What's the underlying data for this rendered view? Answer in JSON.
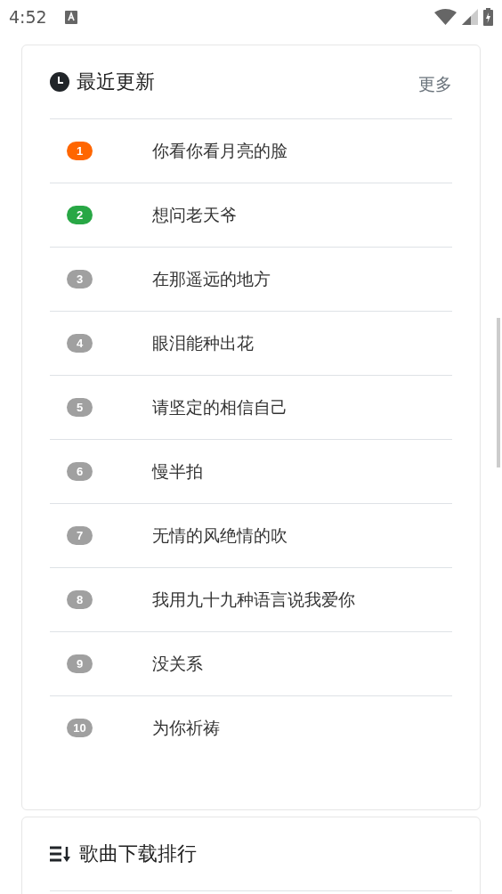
{
  "status_bar": {
    "time": "4:52"
  },
  "recent": {
    "title": "最近更新",
    "more": "更多",
    "items": [
      {
        "rank": "1",
        "title": "你看你看月亮的脸",
        "color": "#ff6600"
      },
      {
        "rank": "2",
        "title": "想问老天爷",
        "color": "#28a745"
      },
      {
        "rank": "3",
        "title": "在那遥远的地方",
        "color": "#a0a0a0"
      },
      {
        "rank": "4",
        "title": "眼泪能种出花",
        "color": "#a0a0a0"
      },
      {
        "rank": "5",
        "title": "请坚定的相信自己",
        "color": "#a0a0a0"
      },
      {
        "rank": "6",
        "title": "慢半拍",
        "color": "#a0a0a0"
      },
      {
        "rank": "7",
        "title": "无情的风绝情的吹",
        "color": "#a0a0a0"
      },
      {
        "rank": "8",
        "title": "我用九十九种语言说我爱你",
        "color": "#a0a0a0"
      },
      {
        "rank": "9",
        "title": "没关系",
        "color": "#a0a0a0"
      },
      {
        "rank": "10",
        "title": "为你祈祷",
        "color": "#a0a0a0"
      }
    ]
  },
  "downloads": {
    "title": "歌曲下载排行"
  }
}
